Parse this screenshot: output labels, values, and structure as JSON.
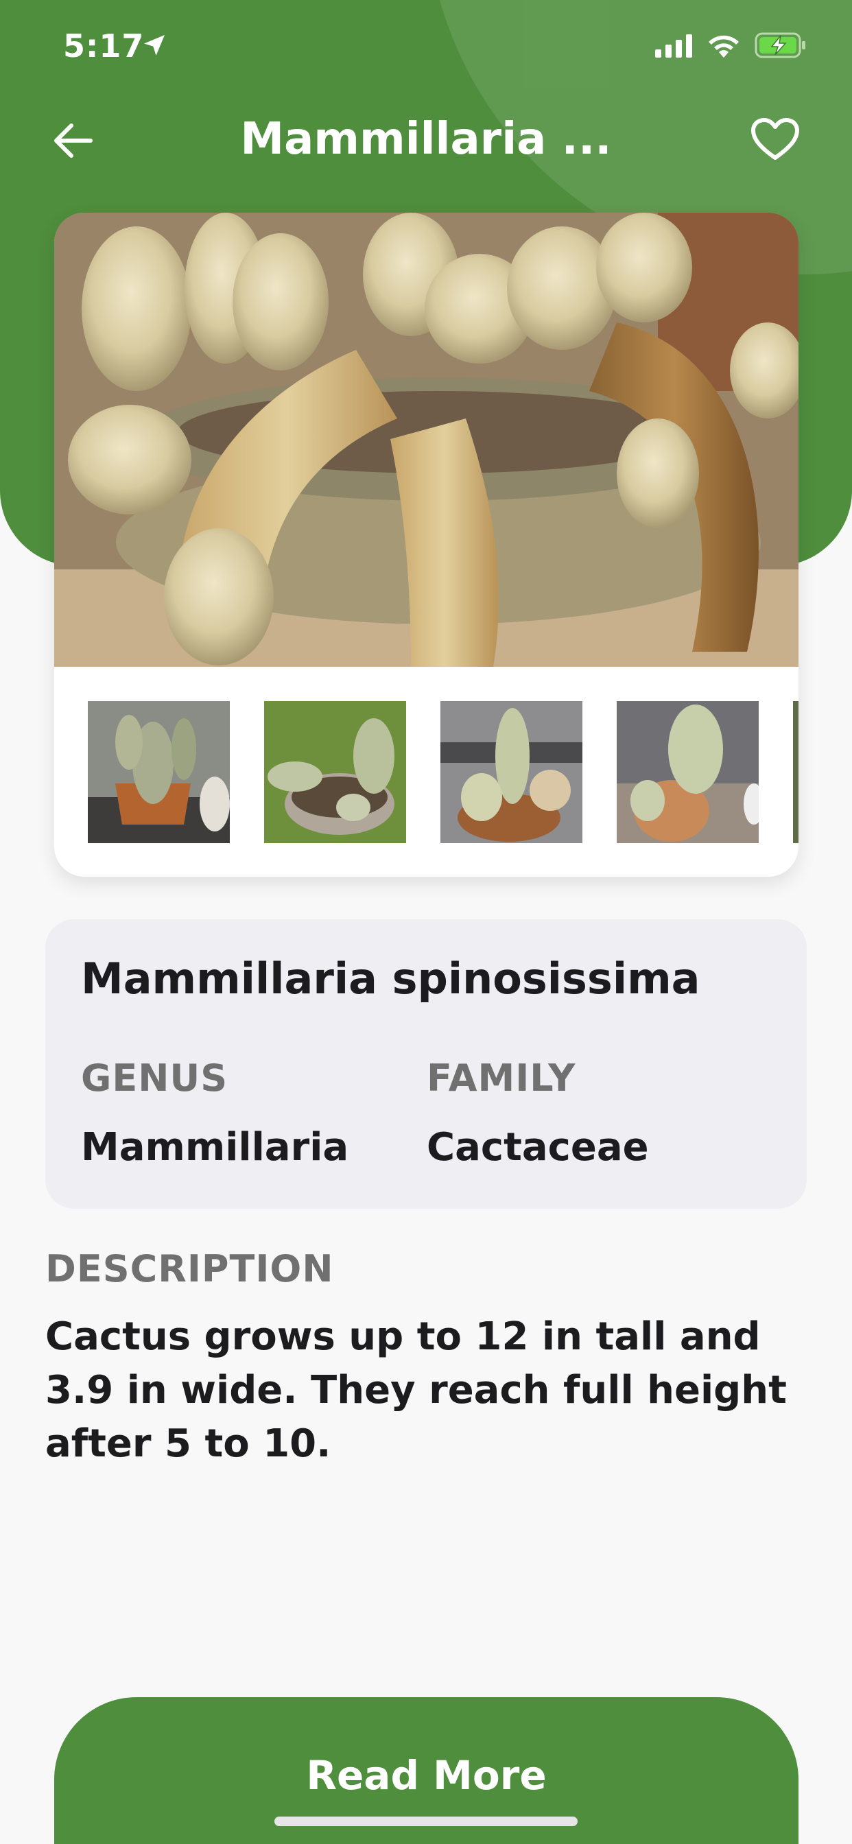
{
  "status_bar": {
    "time": "5:17"
  },
  "nav": {
    "title": "Mammillaria ...",
    "back_icon": "arrow-left-icon",
    "favorite_icon": "heart-outline-icon"
  },
  "gallery": {
    "main_photo": "cactus-main-photo",
    "thumbnails": [
      "thumbnail-1",
      "thumbnail-2",
      "thumbnail-3",
      "thumbnail-4",
      "thumbnail-5"
    ]
  },
  "plant": {
    "name": "Mammillaria spinosissima",
    "genus_label": "GENUS",
    "genus": "Mammillaria",
    "family_label": "FAMILY",
    "family": "Cactaceae"
  },
  "description": {
    "heading": "DESCRIPTION",
    "text": "Cactus grows up to 12 in tall and 3.9 in wide. They reach full height after 5 to 10."
  },
  "actions": {
    "read_more": "Read More"
  },
  "colors": {
    "brand_green": "#4f8e3d",
    "card_gray": "#efeff3",
    "label_gray": "#707070"
  }
}
